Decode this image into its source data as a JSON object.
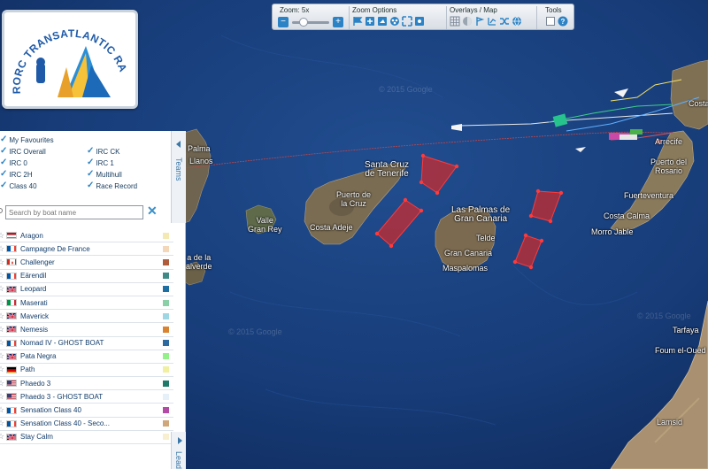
{
  "logo": {
    "line1": "RORC TRANSATLANTIC RACE"
  },
  "toolbar": {
    "zoom_label": "Zoom: 5x",
    "zoom_level_fraction": 0.3,
    "zoom_options_label": "Zoom Options",
    "overlays_label": "Overlays / Map",
    "tools_label": "Tools"
  },
  "map": {
    "places": [
      {
        "name": "Palma",
        "label": "Palma"
      },
      {
        "name": "llanos",
        "label": "Llanos"
      },
      {
        "name": "santa-cruz",
        "label": "Santa Cruz\nde Tenerife"
      },
      {
        "name": "puerto-de-la-cruz",
        "label": "Puerto de\nla Cruz"
      },
      {
        "name": "costa-adeje",
        "label": "Costa Adeje"
      },
      {
        "name": "valle-gran-rey",
        "label": "Valle\nGran Rey"
      },
      {
        "name": "las-palmas",
        "label": "Las Palmas de\nGran Canaria"
      },
      {
        "name": "telde",
        "label": "Telde"
      },
      {
        "name": "gran-canaria",
        "label": "Gran Canaria"
      },
      {
        "name": "maspalomas",
        "label": "Maspalomas"
      },
      {
        "name": "arrecife",
        "label": "Arrecife"
      },
      {
        "name": "puerto-del-rosario",
        "label": "Puerto del\nRosario"
      },
      {
        "name": "fuerteventura",
        "label": "Fuerteventura"
      },
      {
        "name": "costa-calma",
        "label": "Costa Calma"
      },
      {
        "name": "morro-jable",
        "label": "Morro Jable"
      },
      {
        "name": "de-la-palma",
        "label": "a de la\nalverde"
      },
      {
        "name": "tarfaya",
        "label": "Tarfaya"
      },
      {
        "name": "foum-el-oued",
        "label": "Foum el-Oued"
      },
      {
        "name": "lamsid",
        "label": "Lamsid"
      },
      {
        "name": "costa",
        "label": "Costa"
      }
    ],
    "watermark": "© 2015 Google"
  },
  "panel": {
    "teams_tab": "Teams",
    "leaderboard_tab": "Leader",
    "filters": [
      {
        "label": "My Favourites"
      },
      {
        "label": "IRC Overall"
      },
      {
        "label": "IRC CK"
      },
      {
        "label": "IRC 0"
      },
      {
        "label": "IRC 1"
      },
      {
        "label": "IRC 2H"
      },
      {
        "label": "Multihull"
      },
      {
        "label": "Class 40"
      },
      {
        "label": "Race Record"
      }
    ],
    "search_placeholder": "Search by boat name",
    "boats": [
      {
        "name": "Aragon",
        "flag": "nl",
        "color": "#f5e9b3"
      },
      {
        "name": "Campagne De France",
        "flag": "fr",
        "color": "#f4d6b8"
      },
      {
        "name": "Challenger",
        "flag": "ca",
        "color": "#b25b3b"
      },
      {
        "name": "Eärendil",
        "flag": "fr",
        "color": "#3f8a86"
      },
      {
        "name": "Leopard",
        "flag": "gb",
        "color": "#1d6fa3"
      },
      {
        "name": "Maserati",
        "flag": "it",
        "color": "#8ad0a6"
      },
      {
        "name": "Maverick",
        "flag": "gb",
        "color": "#9fd6e3"
      },
      {
        "name": "Nemesis",
        "flag": "gb",
        "color": "#d9822f"
      },
      {
        "name": "Nomad IV - GHOST BOAT",
        "flag": "fr",
        "color": "#2d6aa0"
      },
      {
        "name": "Pata Negra",
        "flag": "gb",
        "color": "#93f08a"
      },
      {
        "name": "Path",
        "flag": "de",
        "color": "#f0f0a0"
      },
      {
        "name": "Phaedo 3",
        "flag": "us",
        "color": "#1f7a6a"
      },
      {
        "name": "Phaedo 3 - GHOST BOAT",
        "flag": "us",
        "color": "#e6f0f8"
      },
      {
        "name": "Sensation Class 40",
        "flag": "fr",
        "color": "#b24aa6"
      },
      {
        "name": "Sensation Class 40 - Seco...",
        "flag": "fr",
        "color": "#cfa77a"
      },
      {
        "name": "Stay Calm",
        "flag": "gb",
        "color": "#f8efd0"
      }
    ]
  },
  "colors": {
    "sea": "#17386f",
    "land": "#7a6b52",
    "zone": "#d42a2a",
    "accent": "#2b82c4"
  }
}
